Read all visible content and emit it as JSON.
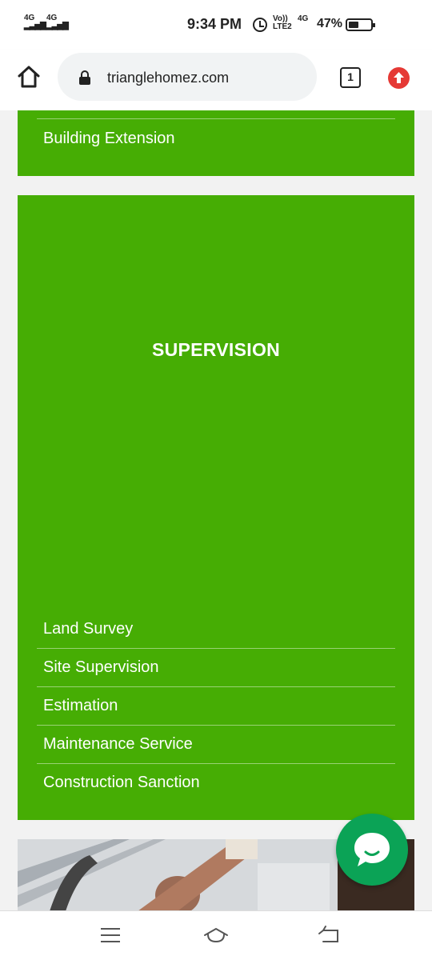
{
  "status_bar": {
    "sim1": "4G",
    "sim2": "4G",
    "time": "9:34 PM",
    "volte_top": "Vo))",
    "volte_bottom": "LTE2",
    "net": "4G",
    "battery": "47%",
    "battery_level": 0.47
  },
  "browser": {
    "url": "trianglehomez.com",
    "tab_count": "1"
  },
  "menu_top": {
    "items": [
      "Building Extension"
    ]
  },
  "supervision": {
    "title": "SUPERVISION",
    "items": [
      "Land Survey",
      "Site Supervision",
      "Estimation",
      "Maintenance Service",
      "Construction Sanction"
    ]
  },
  "colors": {
    "accent_green": "#46ad04",
    "chat_green": "#0ba356"
  }
}
